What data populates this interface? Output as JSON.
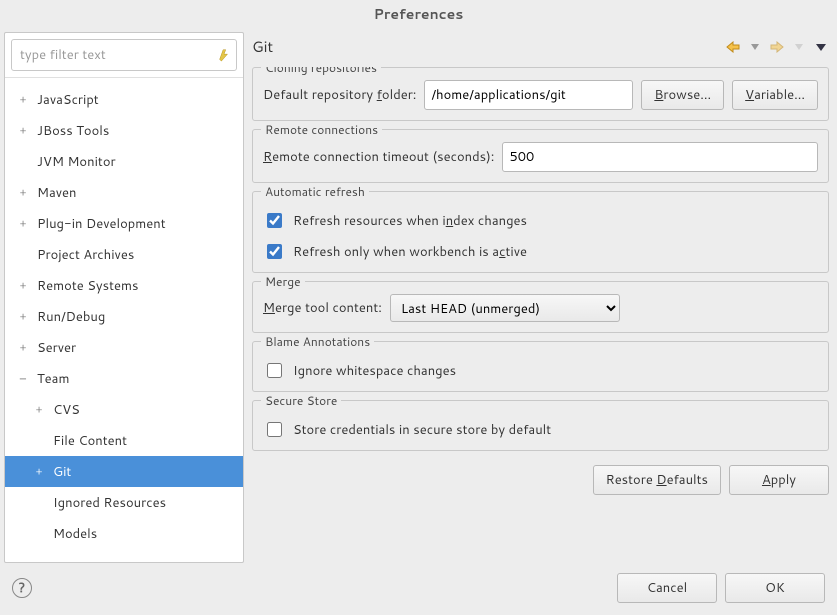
{
  "window": {
    "title": "Preferences"
  },
  "filter": {
    "placeholder": "type filter text"
  },
  "tree": {
    "items": [
      {
        "label": "JavaScript",
        "depth": 0,
        "toggle": "+",
        "selected": false
      },
      {
        "label": "JBoss Tools",
        "depth": 0,
        "toggle": "+",
        "selected": false
      },
      {
        "label": "JVM Monitor",
        "depth": 0,
        "toggle": "",
        "selected": false
      },
      {
        "label": "Maven",
        "depth": 0,
        "toggle": "+",
        "selected": false
      },
      {
        "label": "Plug-in Development",
        "depth": 0,
        "toggle": "+",
        "selected": false
      },
      {
        "label": "Project Archives",
        "depth": 0,
        "toggle": "",
        "selected": false
      },
      {
        "label": "Remote Systems",
        "depth": 0,
        "toggle": "+",
        "selected": false
      },
      {
        "label": "Run/Debug",
        "depth": 0,
        "toggle": "+",
        "selected": false
      },
      {
        "label": "Server",
        "depth": 0,
        "toggle": "+",
        "selected": false
      },
      {
        "label": "Team",
        "depth": 0,
        "toggle": "−",
        "selected": false
      },
      {
        "label": "CVS",
        "depth": 1,
        "toggle": "+",
        "selected": false
      },
      {
        "label": "File Content",
        "depth": 1,
        "toggle": "",
        "selected": false
      },
      {
        "label": "Git",
        "depth": 1,
        "toggle": "+",
        "selected": true
      },
      {
        "label": "Ignored Resources",
        "depth": 1,
        "toggle": "",
        "selected": false
      },
      {
        "label": "Models",
        "depth": 1,
        "toggle": "",
        "selected": false
      }
    ]
  },
  "page": {
    "title": "Git",
    "clone": {
      "legend": "Cloning repositories",
      "folder_label_pre": "Default repository ",
      "folder_label_u": "f",
      "folder_label_post": "older:",
      "folder_value": "/home/applications/git",
      "browse_pre": "",
      "browse_u": "B",
      "browse_post": "rowse...",
      "variable_pre": "",
      "variable_u": "V",
      "variable_post": "ariable..."
    },
    "remote": {
      "legend": "Remote connections",
      "label_u": "R",
      "label_post": "emote connection timeout (seconds):",
      "value": "500"
    },
    "refresh": {
      "legend": "Automatic refresh",
      "cb1_pre": "Refresh resources when i",
      "cb1_u": "n",
      "cb1_post": "dex changes",
      "cb1_checked": true,
      "cb2_pre": "Refresh only when workbench is a",
      "cb2_u": "c",
      "cb2_post": "tive",
      "cb2_checked": true
    },
    "merge": {
      "legend": "Merge",
      "label_u": "M",
      "label_post": "erge tool content:",
      "selected": "Last HEAD (unmerged)"
    },
    "blame": {
      "legend": "Blame Annotations",
      "cb_label": "Ignore whitespace changes",
      "cb_checked": false
    },
    "secure": {
      "legend": "Secure Store",
      "cb_label": "Store credentials in secure store by default",
      "cb_checked": false
    },
    "restore_pre": "Restore ",
    "restore_u": "D",
    "restore_post": "efaults",
    "apply_u": "A",
    "apply_post": "pply"
  },
  "footer": {
    "cancel": "Cancel",
    "ok": "OK"
  }
}
